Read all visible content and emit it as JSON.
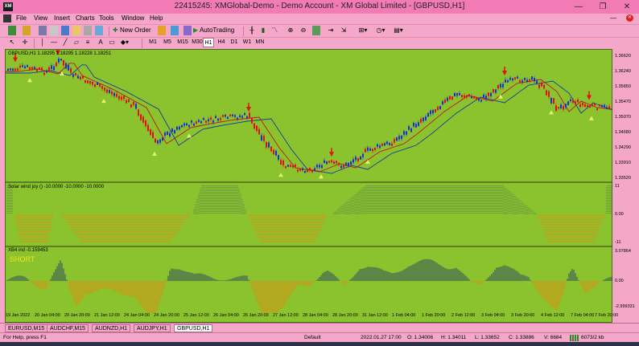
{
  "app": {
    "logo": "XM",
    "title": "22415245: XMGlobal-Demo - Demo Account - XM Global Limited - [GBPUSD,H1]",
    "controls": [
      "—",
      "❐",
      "✕"
    ]
  },
  "menu": [
    "File",
    "View",
    "Insert",
    "Charts",
    "Tools",
    "Window",
    "Help"
  ],
  "toolbar": {
    "new_order": "New Order",
    "autotrading": "AutoTrading",
    "timeframes": [
      "M1",
      "M5",
      "M15",
      "M30",
      "H1",
      "H4",
      "D1",
      "W1",
      "MN"
    ]
  },
  "chart": {
    "symbol_title": "GBPUSD,H1  1.18295 1.18295 1.18228 1.18251",
    "osc1_title": "Solar wind joy ()  -10.0000 -10.0000 -10.0000",
    "osc2_title": "XB4 ind -0.159453",
    "short_label": "SHORT",
    "price_ticks": [
      "1.36620",
      "1.36240",
      "1.35850",
      "1.35470",
      "1.35070",
      "1.34680",
      "1.34290",
      "1.33910",
      "1.33520"
    ],
    "osc1_ticks": [
      "11",
      "0.00",
      "-11"
    ],
    "osc2_ticks": [
      "3.07864",
      "0.00",
      "-2.999331"
    ],
    "x_ticks": [
      "19 Jan 2022",
      "20 Jan 04:00",
      "20 Jan 20:00",
      "21 Jan 12:00",
      "24 Jan 04:00",
      "24 Jan 20:00",
      "25 Jan 12:00",
      "26 Jan 04:00",
      "26 Jan 20:00",
      "27 Jan 12:00",
      "28 Jan 04:00",
      "28 Jan 20:00",
      "31 Jan 12:00",
      "1 Feb 04:00",
      "1 Feb 20:00",
      "2 Feb 12:00",
      "3 Feb 04:00",
      "3 Feb 20:00",
      "4 Feb 12:00",
      "7 Feb 04:00",
      "7 Feb 20:00"
    ],
    "colors": {
      "background": "#8bc32f",
      "bull": "#1a2fd0",
      "bear": "#e01010",
      "ma_red": "#c01818",
      "ma_blue": "#1a3a9a",
      "histo_up": "#1f3d63",
      "histo_down": "#e08a10"
    }
  },
  "tabs": [
    "EURUSD,M15",
    "AUDCHF,M15",
    "AUDNZD,H1",
    "AUDJPY,H1",
    "GBPUSD,H1"
  ],
  "active_tab": "GBPUSD,H1",
  "status": {
    "help": "For Help, press F1",
    "profile": "Default",
    "datetime": "2022.01.27 17:00",
    "open": "O: 1.34006",
    "high": "H: 1.34011",
    "low": "L: 1.33652",
    "close": "C: 1.33886",
    "volume": "V: 6684",
    "traffic": "6073/2 kb"
  }
}
